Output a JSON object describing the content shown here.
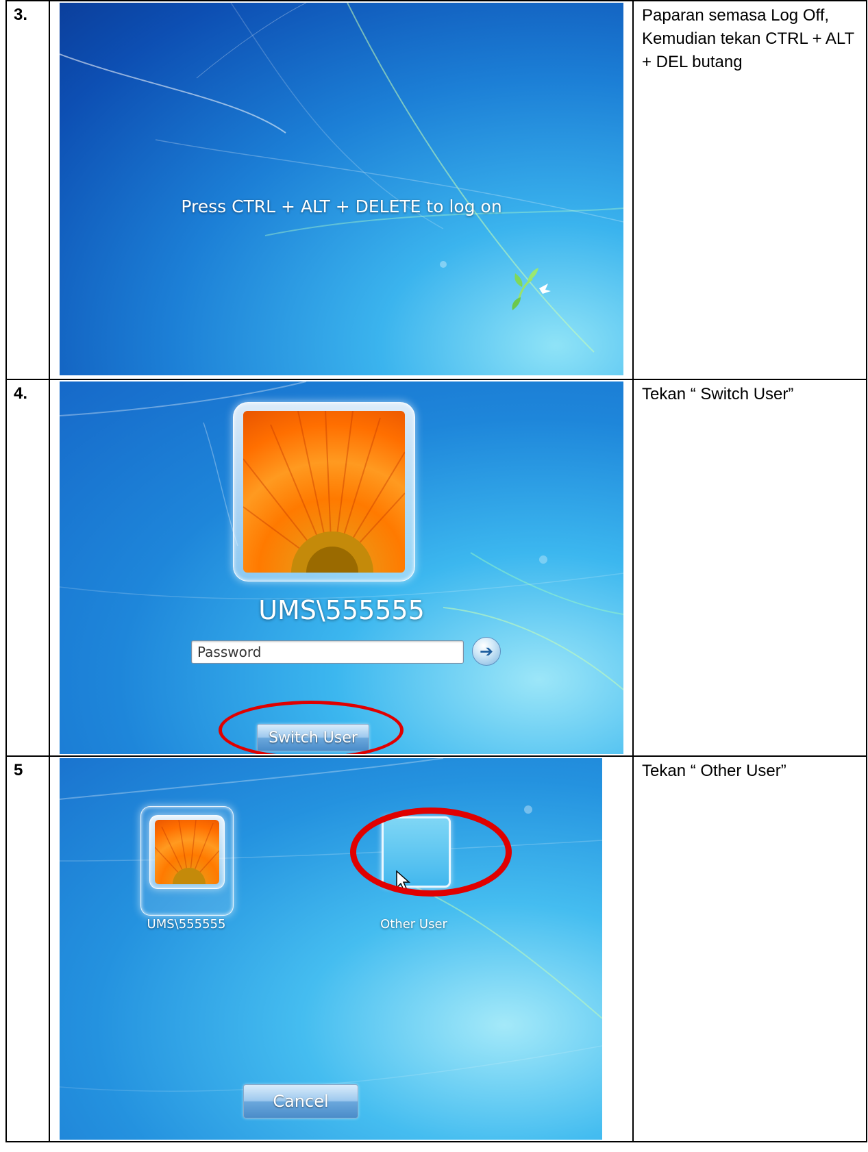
{
  "steps": [
    {
      "num": "3.",
      "screen_text": "Press CTRL + ALT + DELETE to log on",
      "description": "Paparan semasa Log Off, Kemudian tekan CTRL + ALT + DEL butang"
    },
    {
      "num": "4.",
      "username": "UMS\\555555",
      "password_placeholder": "Password",
      "switch_user_label": "Switch User",
      "description": "Tekan “ Switch User”"
    },
    {
      "num": "5",
      "user_tile_label": "UMS\\555555",
      "other_user_label": "Other User",
      "cancel_label": "Cancel",
      "description": "Tekan “ Other User”"
    }
  ],
  "icons": {
    "submit": "arrow-right-icon",
    "cursor": "mouse-pointer-icon"
  },
  "colors": {
    "highlight": "#e00000"
  }
}
